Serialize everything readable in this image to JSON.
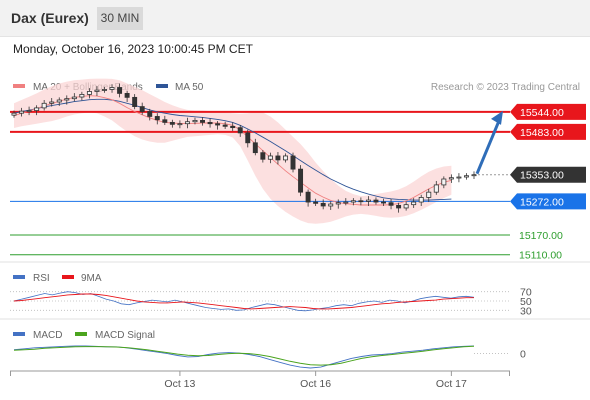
{
  "header": {
    "instrument": "Dax (Eurex)",
    "interval": "30 MIN"
  },
  "timestamp": "Monday, October 16, 2023 10:00:45 PM CET",
  "copyright": "Research © 2023 Trading Central",
  "chart_data": [
    {
      "type": "candlestick",
      "legend": [
        {
          "name": "MA 20 + Bollinger Bands",
          "color": "#f08080"
        },
        {
          "name": "MA 50",
          "color": "#2f5597"
        }
      ],
      "ylim": [
        15100,
        15580
      ],
      "x_ticks": [
        {
          "label": "Oct 13",
          "index": 22
        },
        {
          "label": "Oct 16",
          "index": 40
        },
        {
          "label": "Oct 17",
          "index": 58
        }
      ],
      "levels": [
        {
          "label": "15544.00",
          "value": 15544,
          "color": "#e8161c",
          "kind": "resistance"
        },
        {
          "label": "15483.00",
          "value": 15483,
          "color": "#e8161c",
          "kind": "resistance"
        },
        {
          "label": "15353.00",
          "value": 15353,
          "color": "#333333",
          "kind": "last"
        },
        {
          "label": "15272.00",
          "value": 15272,
          "color": "#1a73e8",
          "kind": "pivot"
        },
        {
          "label": "15170.00",
          "value": 15170,
          "color": "#2e9e2e",
          "kind": "support"
        },
        {
          "label": "15110.00",
          "value": 15110,
          "color": "#2e9e2e",
          "kind": "support"
        }
      ],
      "close": [
        15540,
        15546,
        15548,
        15556,
        15570,
        15574,
        15580,
        15584,
        15589,
        15597,
        15606,
        15610,
        15612,
        15618,
        15600,
        15588,
        15560,
        15545,
        15530,
        15520,
        15512,
        15506,
        15508,
        15514,
        15518,
        15512,
        15508,
        15504,
        15500,
        15496,
        15480,
        15450,
        15420,
        15400,
        15410,
        15398,
        15410,
        15370,
        15300,
        15270,
        15266,
        15258,
        15264,
        15268,
        15270,
        15274,
        15272,
        15276,
        15270,
        15268,
        15260,
        15252,
        15262,
        15270,
        15284,
        15300,
        15322,
        15340,
        15344,
        15346,
        15350,
        15353
      ],
      "bb_upper": [
        15570,
        15580,
        15590,
        15600,
        15612,
        15622,
        15630,
        15636,
        15640,
        15642,
        15644,
        15645,
        15645,
        15644,
        15640,
        15630,
        15620,
        15610,
        15598,
        15586,
        15574,
        15564,
        15556,
        15550,
        15548,
        15548,
        15546,
        15544,
        15542,
        15540,
        15538,
        15540,
        15545,
        15542,
        15530,
        15512,
        15490,
        15468,
        15446,
        15420,
        15390,
        15364,
        15340,
        15320,
        15304,
        15294,
        15288,
        15290,
        15294,
        15298,
        15302,
        15308,
        15318,
        15332,
        15348,
        15362,
        15372,
        15378,
        15380
      ],
      "bb_lower": [
        15495,
        15500,
        15504,
        15508,
        15512,
        15516,
        15522,
        15530,
        15536,
        15540,
        15542,
        15540,
        15530,
        15518,
        15500,
        15484,
        15470,
        15460,
        15454,
        15450,
        15450,
        15456,
        15462,
        15468,
        15470,
        15472,
        15474,
        15476,
        15474,
        15466,
        15440,
        15396,
        15350,
        15310,
        15280,
        15258,
        15240,
        15226,
        15214,
        15206,
        15204,
        15206,
        15210,
        15218,
        15226,
        15232,
        15234,
        15232,
        15228,
        15224,
        15222,
        15224,
        15228,
        15236,
        15246,
        15258,
        15270,
        15282,
        15292
      ],
      "ma20": [
        15532,
        15540,
        15547,
        15554,
        15562,
        15569,
        15576,
        15583,
        15588,
        15591,
        15593,
        15592,
        15587,
        15581,
        15570,
        15557,
        15545,
        15535,
        15526,
        15518,
        15512,
        15510,
        15509,
        15509,
        15509,
        15510,
        15510,
        15510,
        15508,
        15503,
        15489,
        15468,
        15447,
        15426,
        15405,
        15385,
        15365,
        15347,
        15330,
        15313,
        15297,
        15285,
        15275,
        15269,
        15265,
        15263,
        15261,
        15261,
        15261,
        15261,
        15262,
        15266,
        15273,
        15284,
        15297,
        15310,
        15321,
        15330,
        15336
      ],
      "ma50": [
        15540,
        15545,
        15549,
        15554,
        15559,
        15563,
        15567,
        15571,
        15575,
        15578,
        15581,
        15582,
        15582,
        15580,
        15576,
        15570,
        15564,
        15557,
        15550,
        15544,
        15540,
        15536,
        15533,
        15531,
        15529,
        15527,
        15524,
        15521,
        15517,
        15512,
        15503,
        15492,
        15480,
        15467,
        15454,
        15440,
        15426,
        15411,
        15396,
        15381,
        15367,
        15353,
        15340,
        15329,
        15318,
        15309,
        15301,
        15294,
        15288,
        15283,
        15280,
        15278,
        15277,
        15276,
        15276,
        15276,
        15277,
        15278,
        15279
      ],
      "projection": {
        "from": 15353,
        "to": 15544
      }
    },
    {
      "type": "line",
      "legend": [
        {
          "name": "RSI",
          "color": "#4472c4"
        },
        {
          "name": "9MA",
          "color": "#e8161c"
        }
      ],
      "ylim": [
        20,
        80
      ],
      "y_ticks": [
        "70",
        "50",
        "30"
      ],
      "rsi": [
        50,
        54,
        58,
        62,
        66,
        63,
        67,
        70,
        68,
        64,
        66,
        60,
        54,
        50,
        44,
        42,
        46,
        49,
        52,
        50,
        48,
        52,
        48,
        44,
        40,
        36,
        34,
        32,
        33,
        30,
        31,
        36,
        40,
        44,
        42,
        38,
        34,
        30,
        29,
        31,
        34,
        36,
        40,
        42,
        40,
        45,
        48,
        50,
        47,
        52,
        50,
        46,
        50,
        55,
        58,
        60,
        58,
        56,
        59,
        60,
        58
      ],
      "ma9": [
        50,
        51,
        53,
        55,
        57,
        59,
        61,
        63,
        64,
        65,
        65,
        64,
        62,
        59,
        56,
        53,
        50,
        48,
        47,
        46,
        46,
        47,
        48,
        47,
        46,
        44,
        42,
        40,
        38,
        36,
        34,
        33,
        34,
        35,
        36,
        37,
        38,
        37,
        36,
        34,
        33,
        33,
        34,
        35,
        36,
        38,
        40,
        42,
        44,
        45,
        47,
        48,
        49,
        50,
        51,
        52,
        54,
        55,
        56,
        57,
        57
      ]
    },
    {
      "type": "line",
      "legend": [
        {
          "name": "MACD",
          "color": "#4472c4"
        },
        {
          "name": "MACD Signal",
          "color": "#4ba41e"
        }
      ],
      "ylim": [
        -16,
        12
      ],
      "y_ticks": [
        "0"
      ],
      "macd": [
        4,
        5,
        6,
        6.5,
        7,
        7.5,
        8,
        8,
        7.5,
        7,
        7,
        6,
        4.5,
        3,
        1.5,
        0,
        -2,
        -3.5,
        -3,
        -1,
        0.5,
        1,
        0.5,
        -1,
        -3,
        -6,
        -9,
        -12,
        -14,
        -15,
        -14,
        -11,
        -8,
        -5,
        -3,
        -1.5,
        -1,
        0,
        1.5,
        2.5,
        3.5,
        5,
        6,
        7,
        7.5,
        8
      ],
      "signal": [
        3.5,
        4,
        4.5,
        5.5,
        6,
        6.5,
        7,
        7.2,
        7.2,
        7,
        6.8,
        6.2,
        5.2,
        4,
        2.5,
        1,
        -0.5,
        -1.8,
        -2.3,
        -2,
        -1,
        0,
        0.4,
        0,
        -1.2,
        -3,
        -5.5,
        -8,
        -10,
        -11.5,
        -12,
        -11.5,
        -10,
        -7.5,
        -5,
        -3.2,
        -2,
        -1,
        0.2,
        1.2,
        2.4,
        3.8,
        5,
        6,
        7,
        7.5
      ]
    }
  ]
}
